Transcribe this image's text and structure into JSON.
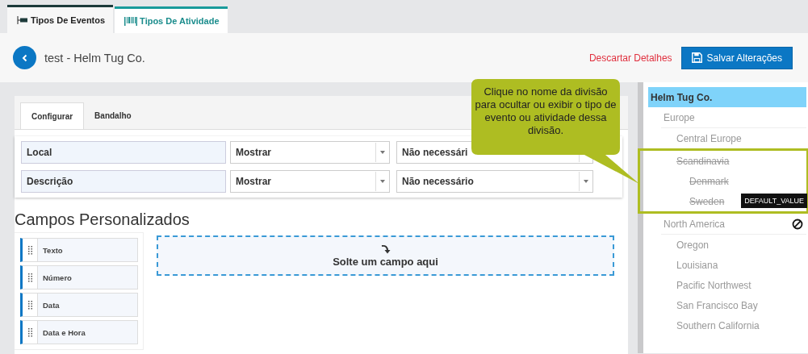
{
  "top_tabs": [
    {
      "label": "Tipos De Eventos",
      "selected": true
    },
    {
      "label": "Tipos De Atividade",
      "selected": false
    }
  ],
  "header": {
    "title": "test - Helm Tug Co.",
    "discard": "Descartar Detalhes",
    "save": "Salvar Alterações"
  },
  "sub_tabs": [
    {
      "label": "Configurar",
      "selected": true
    },
    {
      "label": "Bandalho",
      "selected": false
    }
  ],
  "fields": [
    {
      "name": "Local",
      "visibility": "Mostrar",
      "requirement": "Não necessári"
    },
    {
      "name": "Descrição",
      "visibility": "Mostrar",
      "requirement": "Não necessário"
    }
  ],
  "custom_fields": {
    "title": "Campos Personalizados",
    "items": [
      "Texto",
      "Número",
      "Data",
      "Data e Hora"
    ],
    "drop_zone": "Solte um campo aqui"
  },
  "callout": "Clique no nome da divisão para ocultar ou exibir o tipo de evento ou atividade dessa divisão.",
  "tooltip": "DEFAULT_VALUE",
  "divisions": [
    {
      "name": "Helm Tug Co.",
      "selected": true,
      "hidden": false,
      "children": [
        {
          "name": "Europe",
          "selected": false,
          "hidden": false,
          "children": [
            {
              "name": "Central Europe",
              "selected": false,
              "hidden": false
            },
            {
              "name": "Scandinavia",
              "selected": false,
              "hidden": true,
              "highlighted": true,
              "children": [
                {
                  "name": "Denmark",
                  "selected": false,
                  "hidden": true
                },
                {
                  "name": "Sweden",
                  "selected": false,
                  "hidden": true
                }
              ]
            }
          ]
        },
        {
          "name": "North America",
          "selected": false,
          "hidden": false,
          "blocked": true,
          "children": [
            {
              "name": "Oregon",
              "selected": false,
              "hidden": false
            },
            {
              "name": "Louisiana",
              "selected": false,
              "hidden": false
            },
            {
              "name": "Pacific Northwest",
              "selected": false,
              "hidden": false
            },
            {
              "name": "San Francisco Bay",
              "selected": false,
              "hidden": false
            },
            {
              "name": "Southern California",
              "selected": false,
              "hidden": false
            }
          ]
        }
      ]
    }
  ]
}
